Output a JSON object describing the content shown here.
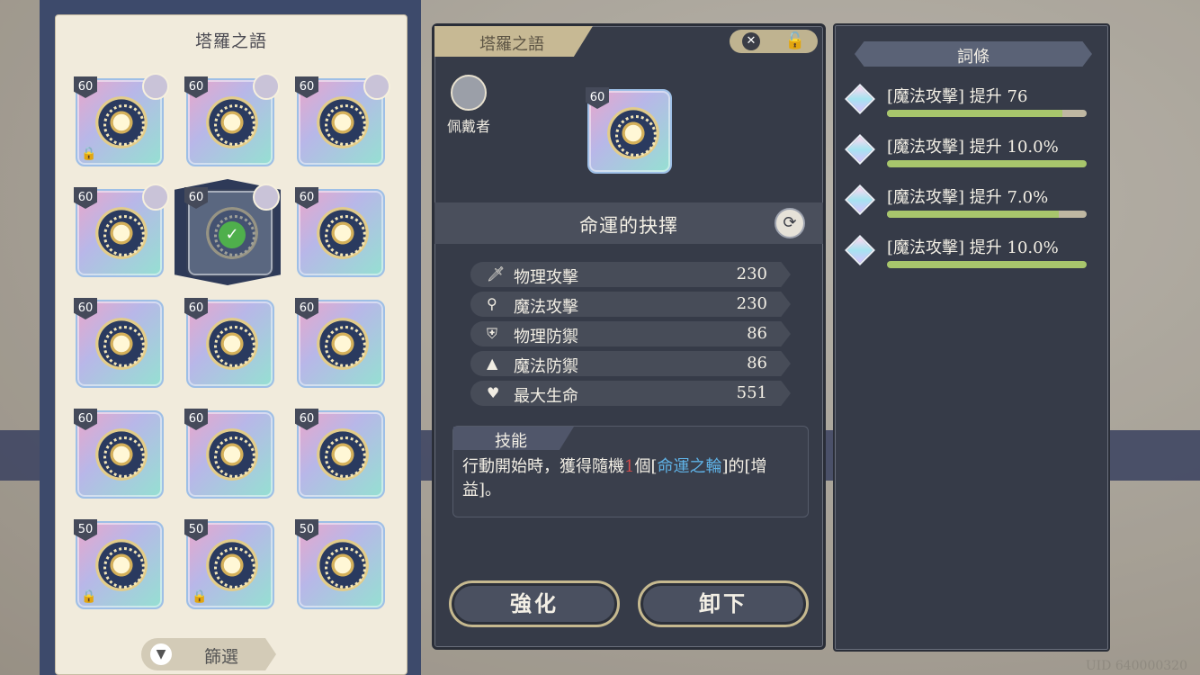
{
  "left_panel": {
    "title": "塔羅之語",
    "filter_label": "篩選",
    "filter_icon": "filter-icon",
    "cards": [
      {
        "level": "60",
        "locked": true,
        "equipped_avatar": true,
        "selected": false
      },
      {
        "level": "60",
        "locked": false,
        "equipped_avatar": true,
        "selected": false
      },
      {
        "level": "60",
        "locked": false,
        "equipped_avatar": true,
        "selected": false
      },
      {
        "level": "60",
        "locked": false,
        "equipped_avatar": true,
        "selected": false
      },
      {
        "level": "60",
        "locked": false,
        "equipped_avatar": true,
        "selected": true
      },
      {
        "level": "60",
        "locked": false,
        "equipped_avatar": false,
        "selected": false
      },
      {
        "level": "60",
        "locked": false,
        "equipped_avatar": false,
        "selected": false
      },
      {
        "level": "60",
        "locked": false,
        "equipped_avatar": false,
        "selected": false
      },
      {
        "level": "60",
        "locked": false,
        "equipped_avatar": false,
        "selected": false
      },
      {
        "level": "60",
        "locked": false,
        "equipped_avatar": false,
        "selected": false
      },
      {
        "level": "60",
        "locked": false,
        "equipped_avatar": false,
        "selected": false
      },
      {
        "level": "60",
        "locked": false,
        "equipped_avatar": false,
        "selected": false
      },
      {
        "level": "50",
        "locked": true,
        "equipped_avatar": false,
        "selected": false
      },
      {
        "level": "50",
        "locked": true,
        "equipped_avatar": false,
        "selected": false
      },
      {
        "level": "50",
        "locked": false,
        "equipped_avatar": false,
        "selected": false
      }
    ]
  },
  "detail": {
    "header_title": "塔羅之語",
    "wearer_label": "佩戴者",
    "item_level": "60",
    "item_name": "命運的抉擇",
    "stats": [
      {
        "icon": "sword-icon",
        "glyph": "🗡",
        "name": "物理攻擊",
        "value": "230"
      },
      {
        "icon": "staff-icon",
        "glyph": "⚲",
        "name": "魔法攻擊",
        "value": "230"
      },
      {
        "icon": "shield-icon",
        "glyph": "⛨",
        "name": "物理防禦",
        "value": "86"
      },
      {
        "icon": "hat-icon",
        "glyph": "▲",
        "name": "魔法防禦",
        "value": "86"
      },
      {
        "icon": "heart-icon",
        "glyph": "♥",
        "name": "最大生命",
        "value": "551"
      }
    ],
    "skill": {
      "title": "技能",
      "text_before": "行動開始時，獲得隨機",
      "num": "1",
      "text_mid": "個[",
      "keyword": "命運之輪",
      "text_after": "]的[增益]。"
    },
    "buttons": {
      "enhance": "強化",
      "unequip": "卸下"
    }
  },
  "affixes": {
    "title": "詞條",
    "items": [
      {
        "text": "[魔法攻擊] 提升 76",
        "progress": 0.88
      },
      {
        "text": "[魔法攻擊] 提升 10.0%",
        "progress": 1.0
      },
      {
        "text": "[魔法攻擊] 提升 7.0%",
        "progress": 0.86
      },
      {
        "text": "[魔法攻擊] 提升 10.0%",
        "progress": 1.0
      }
    ]
  },
  "uid": "UID 640000320"
}
